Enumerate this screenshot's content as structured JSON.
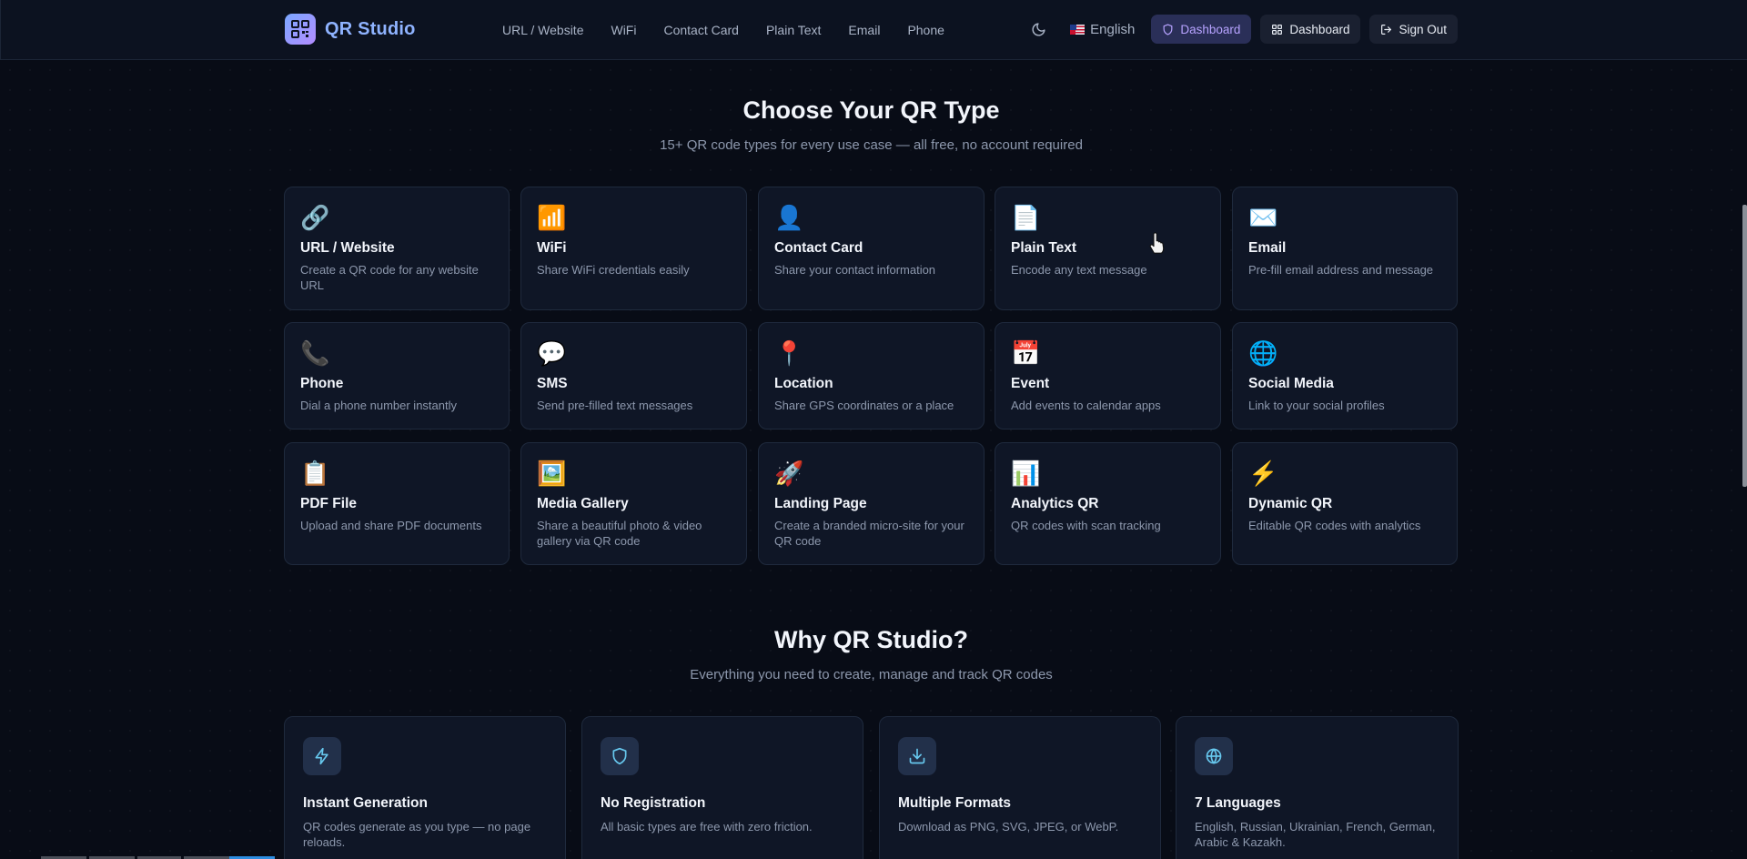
{
  "brand": {
    "name": "QR Studio",
    "logo_icon": "qr-code-icon"
  },
  "nav": [
    {
      "label": "URL / Website"
    },
    {
      "label": "WiFi"
    },
    {
      "label": "Contact Card"
    },
    {
      "label": "Plain Text"
    },
    {
      "label": "Email"
    },
    {
      "label": "Phone"
    }
  ],
  "header_right": {
    "theme_icon": "moon-icon",
    "language": "English",
    "dashboard_primary": "Dashboard",
    "dashboard_secondary": "Dashboard",
    "sign_out": "Sign Out"
  },
  "types_section": {
    "title": "Choose Your QR Type",
    "subtitle": "15+ QR code types for every use case — all free, no account required",
    "cards": [
      {
        "icon": "🔗",
        "title": "URL / Website",
        "desc": "Create a QR code for any website URL"
      },
      {
        "icon": "📶",
        "title": "WiFi",
        "desc": "Share WiFi credentials easily"
      },
      {
        "icon": "👤",
        "title": "Contact Card",
        "desc": "Share your contact information"
      },
      {
        "icon": "📄",
        "title": "Plain Text",
        "desc": "Encode any text message"
      },
      {
        "icon": "✉️",
        "title": "Email",
        "desc": "Pre-fill email address and message"
      },
      {
        "icon": "📞",
        "title": "Phone",
        "desc": "Dial a phone number instantly"
      },
      {
        "icon": "💬",
        "title": "SMS",
        "desc": "Send pre-filled text messages"
      },
      {
        "icon": "📍",
        "title": "Location",
        "desc": "Share GPS coordinates or a place"
      },
      {
        "icon": "📅",
        "title": "Event",
        "desc": "Add events to calendar apps"
      },
      {
        "icon": "🌐",
        "title": "Social Media",
        "desc": "Link to your social profiles"
      },
      {
        "icon": "📋",
        "title": "PDF File",
        "desc": "Upload and share PDF documents"
      },
      {
        "icon": "🖼️",
        "title": "Media Gallery",
        "desc": "Share a beautiful photo & video gallery via QR code"
      },
      {
        "icon": "🚀",
        "title": "Landing Page",
        "desc": "Create a branded micro-site for your QR code"
      },
      {
        "icon": "📊",
        "title": "Analytics QR",
        "desc": "QR codes with scan tracking"
      },
      {
        "icon": "⚡",
        "title": "Dynamic QR",
        "desc": "Editable QR codes with analytics"
      }
    ]
  },
  "why_section": {
    "title": "Why QR Studio?",
    "subtitle": "Everything you need to create, manage and track QR codes",
    "features": [
      {
        "icon": "lightning-icon",
        "title": "Instant Generation",
        "desc": "QR codes generate as you type — no page reloads."
      },
      {
        "icon": "shield-icon",
        "title": "No Registration",
        "desc": "All basic types are free with zero friction."
      },
      {
        "icon": "download-icon",
        "title": "Multiple Formats",
        "desc": "Download as PNG, SVG, JPEG, or WebP."
      },
      {
        "icon": "globe-icon",
        "title": "7 Languages",
        "desc": "English, Russian, Ukrainian, French, German, Arabic & Kazakh."
      }
    ]
  },
  "colors": {
    "accent": "#8fb3ff",
    "primary_button": "#b7a3ff",
    "background": "#080c16"
  }
}
